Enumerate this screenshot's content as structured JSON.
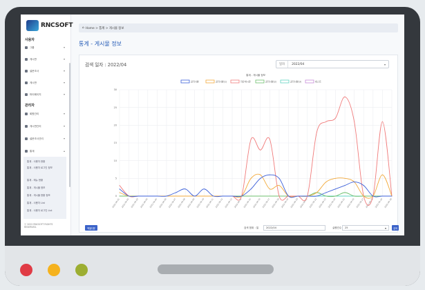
{
  "brand": {
    "name": "RNCSOFT"
  },
  "sidebar": {
    "section_user": "사용자",
    "user_items": [
      {
        "label": "그룹"
      },
      {
        "label": "게시판"
      },
      {
        "label": "설문조사"
      },
      {
        "label": "게시판"
      },
      {
        "label": "마이페이지"
      }
    ],
    "section_admin": "관리자",
    "admin_items": [
      {
        "label": "회원관리"
      },
      {
        "label": "게시판관리"
      },
      {
        "label": "설문조사관리"
      },
      {
        "label": "통계"
      }
    ],
    "sub_items": [
      {
        "label": "통계 - 사용자 현황"
      },
      {
        "label": "통계 - 사용자 로그인 정보"
      },
      {
        "label": "통계 - 메뉴 현황"
      },
      {
        "label": "통계 - 게시물 정보"
      },
      {
        "label": "통계 - 게시물 현황 정보"
      },
      {
        "label": "통계 - 사용자 List"
      },
      {
        "label": "통계 - 사용자 로그인 List"
      }
    ],
    "footer": "ⓒ 2022 RNCSOFT RIGHTS RESERVED."
  },
  "header": {
    "breadcrumb": "Home > 통계 > 게시물 정보",
    "page_title": "통계 - 게시물 정보"
  },
  "filter": {
    "search_date": "검색 일자 : 2022/04",
    "select_label": "일자",
    "select_value": "2022/04"
  },
  "footer": {
    "excel_button": "엑셀다운",
    "period_label": "검색 범위 : 일",
    "period_value": "2022/04",
    "rows_label": "실행건수",
    "rows_value": "25",
    "search_button": "검색"
  },
  "colors": {
    "series": [
      "#3b5fd9",
      "#f2a93b",
      "#f07a7a",
      "#6cbf6c",
      "#5fd3c0",
      "#c58bd8"
    ],
    "accent": "#3c63c9"
  },
  "chart_data": {
    "type": "line",
    "title": "통계 - 게시물 정보",
    "x": [
      "2022-04-01",
      "2022-04-02",
      "2022-04-03",
      "2022-04-04",
      "2022-04-05",
      "2022-04-06",
      "2022-04-07",
      "2022-04-08",
      "2022-04-09",
      "2022-04-10",
      "2022-04-11",
      "2022-04-12",
      "2022-04-13",
      "2022-04-14",
      "2022-04-15",
      "2022-04-16",
      "2022-04-17",
      "2022-04-18",
      "2022-04-19",
      "2022-04-20",
      "2022-04-21",
      "2022-04-22",
      "2022-04-23",
      "2022-04-24",
      "2022-04-25",
      "2022-04-26",
      "2022-04-27",
      "2022-04-28",
      "2022-04-29",
      "2022-04-30"
    ],
    "ylim": [
      0,
      30
    ],
    "yticks": [
      0,
      5,
      10,
      15,
      20,
      25,
      30
    ],
    "grid": true,
    "legend_position": "top",
    "series": [
      {
        "name": "공지사항",
        "values": [
          2,
          0,
          0,
          0,
          0,
          0,
          1,
          2,
          0,
          2,
          0,
          0,
          0,
          0,
          2,
          5,
          6,
          5,
          0,
          0,
          0,
          0,
          1,
          2,
          3,
          4,
          3,
          0,
          0,
          0
        ]
      },
      {
        "name": "공지사항(1)",
        "values": [
          1,
          0,
          0,
          0,
          0,
          0,
          0,
          0,
          0,
          0,
          0,
          0,
          0,
          0,
          5,
          6,
          2,
          3,
          0,
          0,
          0,
          1,
          4,
          5,
          5,
          4,
          0,
          0,
          6,
          0
        ]
      },
      {
        "name": "자유게시판",
        "values": [
          3,
          0,
          0,
          0,
          0,
          0,
          0,
          0,
          0,
          0,
          0,
          0,
          0,
          0,
          16,
          13,
          16,
          0,
          0,
          0,
          0,
          18,
          21,
          22,
          28,
          21,
          0,
          0,
          21,
          0
        ]
      },
      {
        "name": "공지사항(2)",
        "values": [
          0,
          0,
          0,
          0,
          0,
          0,
          0,
          0,
          0,
          0,
          0,
          0,
          0,
          0,
          0,
          0,
          0,
          0,
          0,
          0,
          0,
          1,
          0,
          0,
          1,
          0,
          0,
          0,
          0,
          0
        ]
      },
      {
        "name": "공지사항(3)",
        "values": [
          0,
          0,
          0,
          0,
          0,
          0,
          0,
          0,
          0,
          0,
          0,
          0,
          0,
          0,
          0,
          0,
          0,
          0,
          0,
          0,
          0,
          0,
          0,
          0,
          0,
          0,
          0,
          0,
          0,
          0
        ]
      },
      {
        "name": "테스트",
        "values": [
          0,
          0,
          0,
          0,
          0,
          0,
          0,
          0,
          0,
          0,
          0,
          0,
          0,
          0,
          0,
          0,
          0,
          0,
          0,
          0,
          0,
          0,
          0,
          0,
          0,
          0,
          0,
          0,
          0,
          0
        ]
      }
    ]
  }
}
